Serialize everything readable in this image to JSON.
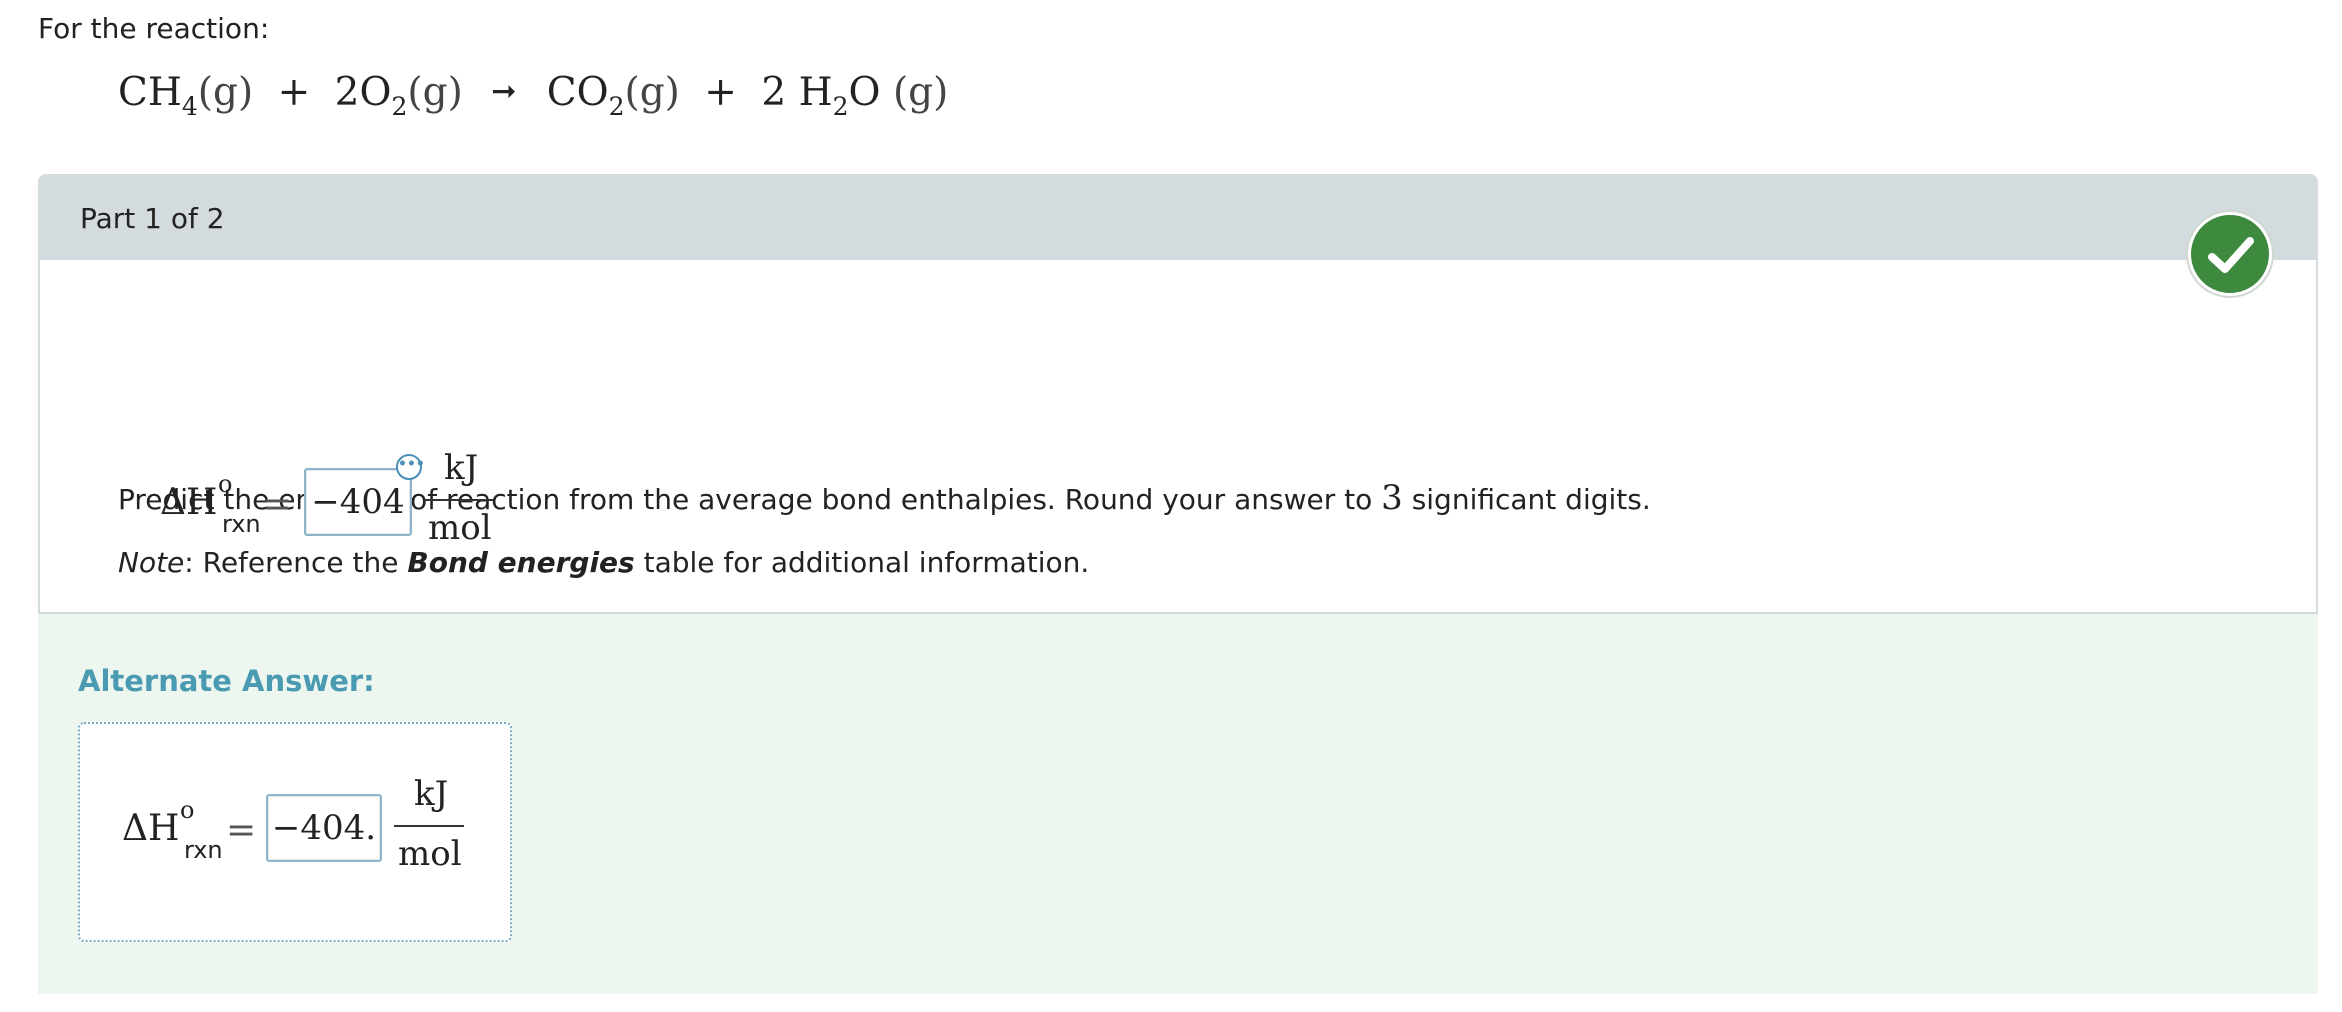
{
  "intro": "For the reaction:",
  "reaction": {
    "r1": "CH",
    "r1_sub": "4",
    "r1_state": "(g)",
    "plus1": "+",
    "r2_coef": "2",
    "r2": "O",
    "r2_sub": "2",
    "r2_state": "(g)",
    "p1": "CO",
    "p1_sub": "2",
    "p1_state": "(g)",
    "plus2": "+",
    "p2_coef": "2",
    "p2_h": "H",
    "p2_sub": "2",
    "p2_o": "O",
    "p2_state": "(g)"
  },
  "part": {
    "label": "Part 1 of 2",
    "status": "correct",
    "status_color": "#3d8a3f"
  },
  "question": {
    "text_before": "Predict the enthalpy of reaction from the average bond enthalpies. Round your answer to",
    "digits": "3",
    "text_after": "significant digits.",
    "note_label": "Note",
    "note_text1": ": Reference the",
    "note_link": "Bond energies",
    "note_text2": "table for additional information."
  },
  "answer": {
    "symbol": "ΔH",
    "superscript": "o",
    "subscript": "rxn",
    "equals": "=",
    "value": "−404",
    "unit_num": "kJ",
    "unit_den": "mol",
    "more_icon": "ellipsis-icon"
  },
  "alternate": {
    "title": "Alternate Answer:",
    "symbol": "ΔH",
    "superscript": "o",
    "subscript": "rxn",
    "equals": "=",
    "value": "−404.",
    "unit_num": "kJ",
    "unit_den": "mol"
  }
}
